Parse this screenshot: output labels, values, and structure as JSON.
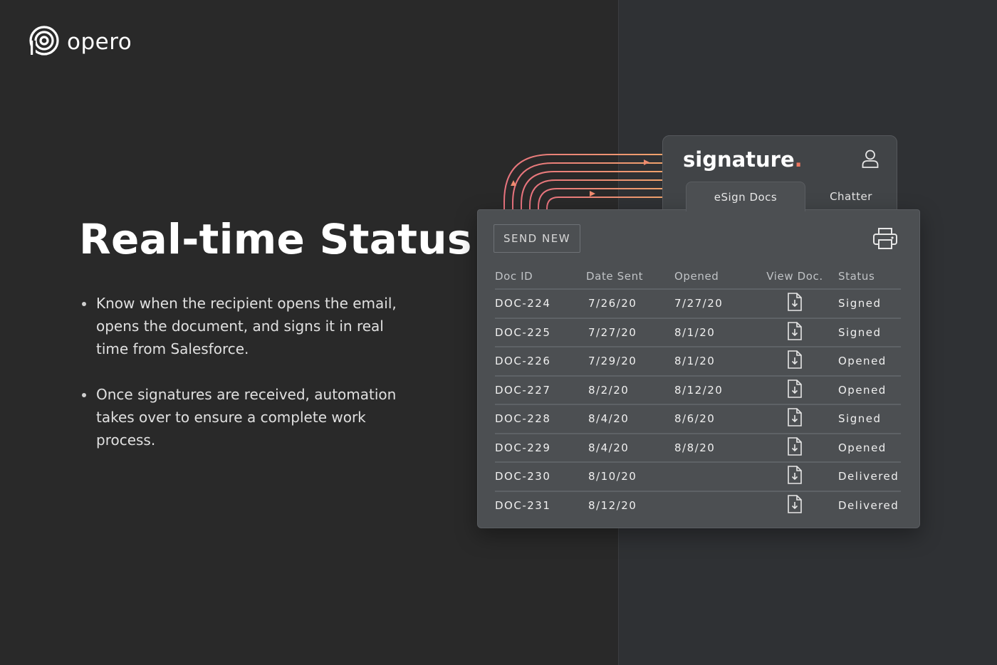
{
  "brand": {
    "name": "opero"
  },
  "headline": "Real-time Status",
  "bullets": [
    "Know when the recipient opens the email, opens the document, and signs it in real time from Salesforce.",
    "Once signatures are received, automation takes over to ensure a complete work process."
  ],
  "signature_app": {
    "logo_text": "signature",
    "logo_dot": ".",
    "tabs": [
      {
        "label": "eSign Docs",
        "active": true
      },
      {
        "label": "Chatter",
        "active": false
      }
    ],
    "send_button": "SEND NEW",
    "columns": [
      "Doc ID",
      "Date Sent",
      "Opened",
      "View Doc.",
      "Status"
    ],
    "rows": [
      {
        "id": "DOC-224",
        "sent": "7/26/20",
        "opened": "7/27/20",
        "status": "Signed"
      },
      {
        "id": "DOC-225",
        "sent": "7/27/20",
        "opened": "8/1/20",
        "status": "Signed"
      },
      {
        "id": "DOC-226",
        "sent": "7/29/20",
        "opened": "8/1/20",
        "status": "Opened"
      },
      {
        "id": "DOC-227",
        "sent": "8/2/20",
        "opened": "8/12/20",
        "status": "Opened"
      },
      {
        "id": "DOC-228",
        "sent": "8/4/20",
        "opened": "8/6/20",
        "status": "Signed"
      },
      {
        "id": "DOC-229",
        "sent": "8/4/20",
        "opened": "8/8/20",
        "status": "Opened"
      },
      {
        "id": "DOC-230",
        "sent": "8/10/20",
        "opened": "",
        "status": "Delivered"
      },
      {
        "id": "DOC-231",
        "sent": "8/12/20",
        "opened": "",
        "status": "Delivered"
      }
    ]
  },
  "colors": {
    "background": "#292929",
    "right_panel": "#2f3134",
    "card": "#4c4f52",
    "accent": "#ee7760",
    "arc_gradient_start": "#e8737e",
    "arc_gradient_end": "#f0a36c"
  },
  "icons": [
    "opero-logo-icon",
    "user-icon",
    "print-icon",
    "document-download-icon"
  ]
}
